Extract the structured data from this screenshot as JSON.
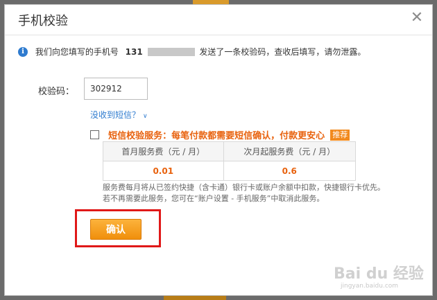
{
  "dialog": {
    "title": "手机校验",
    "close_glyph": "✕"
  },
  "info": {
    "icon_glyph": "i",
    "text_before": "我们向您填写的手机号",
    "phone_prefix": "131",
    "text_after": "发送了一条校验码，查收后填写，请勿泄露。"
  },
  "form": {
    "code_label": "校验码：",
    "code_value": "302912",
    "no_sms_link": "没收到短信？",
    "no_sms_chevron": "∨"
  },
  "sms_service": {
    "checked": false,
    "label": "短信校验服务：每笔付款都需要短信确认，付款更安心",
    "badge": "推荐",
    "fee_headers": [
      "首月服务费（元 / 月）",
      "次月起服务费（元 / 月）"
    ],
    "fee_values": [
      "0.01",
      "0.6"
    ],
    "note_line1": "服务费每月将从已签约快捷（含卡通）银行卡或账户余额中扣款，快捷银行卡优先。",
    "note_line2": "若不再需要此服务，您可在“账户设置 - 手机服务”中取消此服务。"
  },
  "actions": {
    "confirm_label": "确认"
  },
  "watermark": {
    "brand": "Bai du 经验",
    "url": "jingyan.baidu.com"
  },
  "colors": {
    "accent_orange": "#e8620e",
    "link_blue": "#2e7bcf",
    "button_orange": "#f5a01f",
    "highlight_red": "#e01818"
  }
}
